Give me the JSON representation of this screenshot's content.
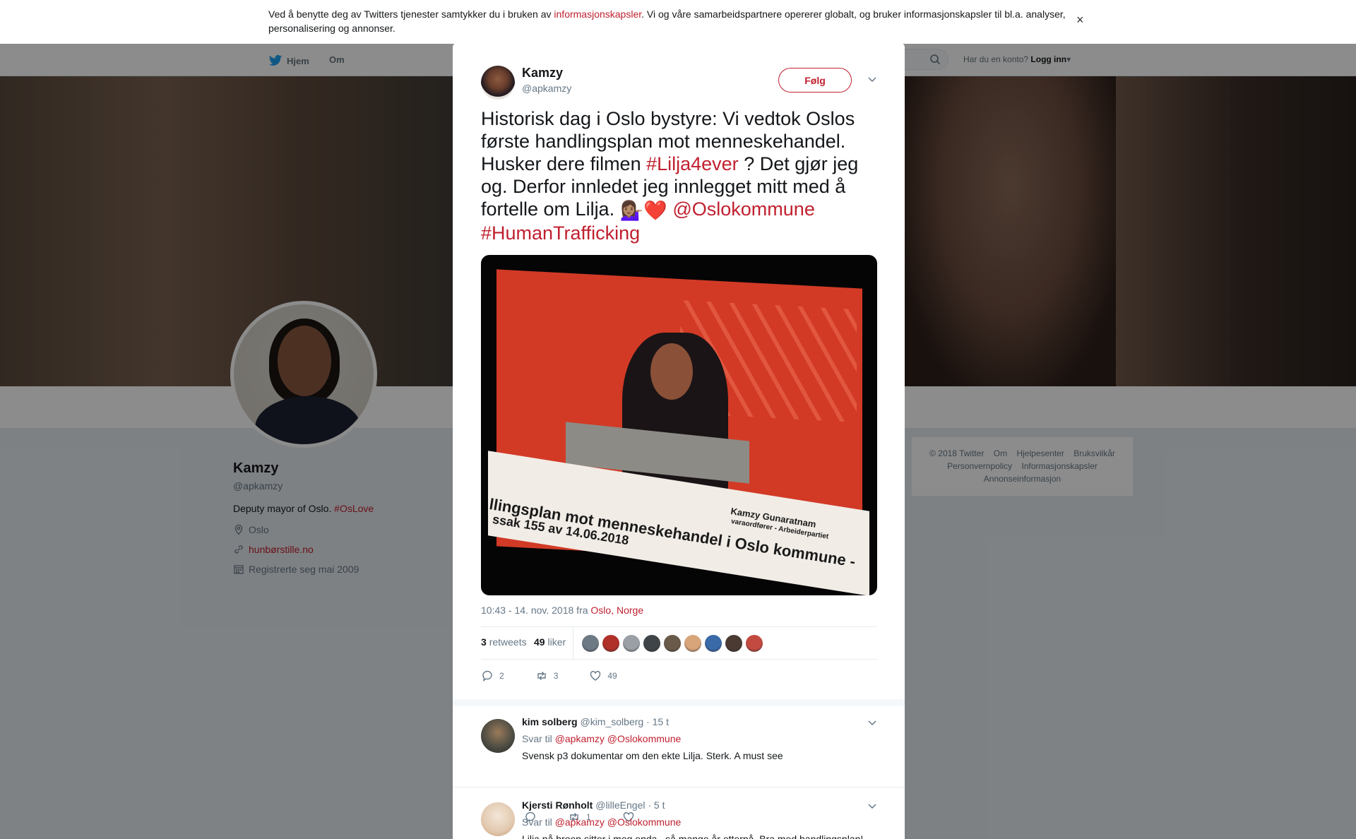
{
  "cookie": {
    "text_before": "Ved å benytte deg av Twitters tjenester samtykker du i bruken av ",
    "link": "informasjonskapsler",
    "text_after": ". Vi og våre samarbeidspartnere opererer globalt, og bruker informasjonskapsler til bl.a. analyser, personalisering og annonser.",
    "close": "×"
  },
  "nav": {
    "home": "Hjem",
    "about": "Om",
    "login_prompt": "Har du en konto?",
    "login": "Logg inn"
  },
  "profile": {
    "name": "Kamzy",
    "handle": "@apkamzy",
    "bio": "Deputy mayor of Oslo. ",
    "bio_tag": "#OsLove",
    "location": "Oslo",
    "website": "hunbørstille.no",
    "joined": "Registrerte seg mai 2009"
  },
  "footer": {
    "links": [
      "© 2018 Twitter",
      "Om",
      "Hjelpesenter",
      "Bruksvilkår",
      "Personvernpolicy",
      "Informasjonskapsler",
      "Annonseinformasjon"
    ]
  },
  "tweet": {
    "name": "Kamzy",
    "handle": "@apkamzy",
    "follow": "Følg",
    "text_1": "Historisk dag i Oslo bystyre: Vi vedtok Oslos første handlingsplan mot menneskehandel. Husker dere filmen ",
    "tag_1": "#Lilja4ever",
    "text_2": " ? Det gjør jeg og. Derfor innledet jeg innlegget mitt med å fortelle om Lilja. ",
    "emoji": "💁🏽‍♀️❤️",
    "mention": "@Oslokommune",
    "tag_2": "#HumanTrafficking",
    "video": {
      "line1": "llingsplan mot menneskehandel i Oslo kommune -",
      "line2": "ssak 155 av 14.06.2018",
      "name": "Kamzy Gunaratnam",
      "role": "varaordfører - Arbeiderpartiet"
    },
    "time": "10:43 - 14. nov. 2018 fra ",
    "place": "Oslo, Norge",
    "retweets_count": "3",
    "retweets_label": "retweets",
    "likes_count": "49",
    "likes_label": "liker",
    "reply_count": "2",
    "retweet_action_count": "3",
    "like_action_count": "49",
    "liker_colors": [
      "#6d7a86",
      "#b0302a",
      "#9aa0a6",
      "#3e4448",
      "#6a5a4a",
      "#d8a47a",
      "#3a6aa8",
      "#4a3a32",
      "#c24a40"
    ]
  },
  "replies": [
    {
      "name": "kim solberg",
      "handle": "@kim_solberg",
      "time": "· 15 t",
      "reply_to_label": "Svar til ",
      "reply_to": "@apkamzy @Oslokommune",
      "text": "Svensk p3 dokumentar om den ekte Lilja. Sterk. A must see",
      "retweets": "1",
      "avatar_color": "#4a4a42"
    },
    {
      "name": "Kjersti Rønholt",
      "handle": "@lilleEngel",
      "time": "· 5 t",
      "reply_to_label": "Svar til ",
      "reply_to": "@apkamzy @Oslokommune",
      "text": "Lilja på broen sitter i meg enda.. så mange år etterpå. Bra med handlingsplan!",
      "avatar_color": "#e2c9b0"
    }
  ]
}
